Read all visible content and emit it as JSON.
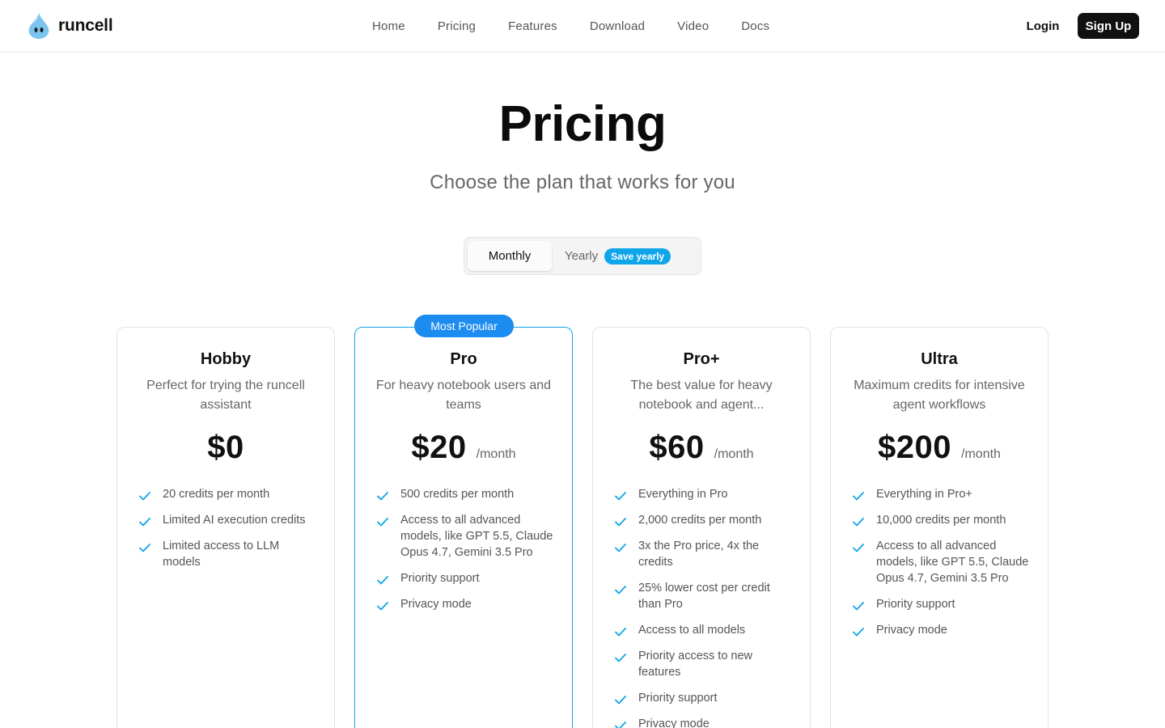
{
  "brand": {
    "name": "runcell"
  },
  "nav": {
    "items": [
      {
        "label": "Home",
        "key": "home"
      },
      {
        "label": "Pricing",
        "key": "pricing"
      },
      {
        "label": "Features",
        "key": "features"
      },
      {
        "label": "Download",
        "key": "download"
      },
      {
        "label": "Video",
        "key": "video"
      },
      {
        "label": "Docs",
        "key": "docs"
      }
    ],
    "login_label": "Login",
    "signup_label": "Sign Up"
  },
  "hero": {
    "title": "Pricing",
    "subtitle": "Choose the plan that works for you"
  },
  "billing_toggle": {
    "monthly_label": "Monthly",
    "yearly_label": "Yearly",
    "yearly_badge": "Save yearly",
    "selected": "Monthly"
  },
  "colors": {
    "accent": "#0ea5e9",
    "popular_badge": "#1d8cf0",
    "check": "#0ea5e9",
    "dark_button": "#111111"
  },
  "plans": [
    {
      "name": "Hobby",
      "description": "Perfect for trying the runcell assistant",
      "price": "$0",
      "period": "",
      "badge": "",
      "featured": false,
      "features": [
        "20 credits per month",
        "Limited AI execution credits",
        "Limited access to LLM models"
      ]
    },
    {
      "name": "Pro",
      "description": "For heavy notebook users and teams",
      "price": "$20",
      "period": "/month",
      "badge": "Most Popular",
      "featured": true,
      "features": [
        "500 credits per month",
        "Access to all advanced models, like GPT 5.5, Claude Opus 4.7, Gemini 3.5 Pro",
        "Priority support",
        "Privacy mode"
      ]
    },
    {
      "name": "Pro+",
      "description": "The best value for heavy notebook and agent...",
      "price": "$60",
      "period": "/month",
      "badge": "",
      "featured": false,
      "features": [
        "Everything in Pro",
        "2,000 credits per month",
        "3x the Pro price, 4x the credits",
        "25% lower cost per credit than Pro",
        "Access to all models",
        "Priority access to new features",
        "Priority support",
        "Privacy mode"
      ]
    },
    {
      "name": "Ultra",
      "description": "Maximum credits for intensive agent workflows",
      "price": "$200",
      "period": "/month",
      "badge": "",
      "featured": false,
      "features": [
        "Everything in Pro+",
        "10,000 credits per month",
        "Access to all advanced models, like GPT 5.5, Claude Opus 4.7, Gemini 3.5 Pro",
        "Priority support",
        "Privacy mode"
      ]
    }
  ]
}
